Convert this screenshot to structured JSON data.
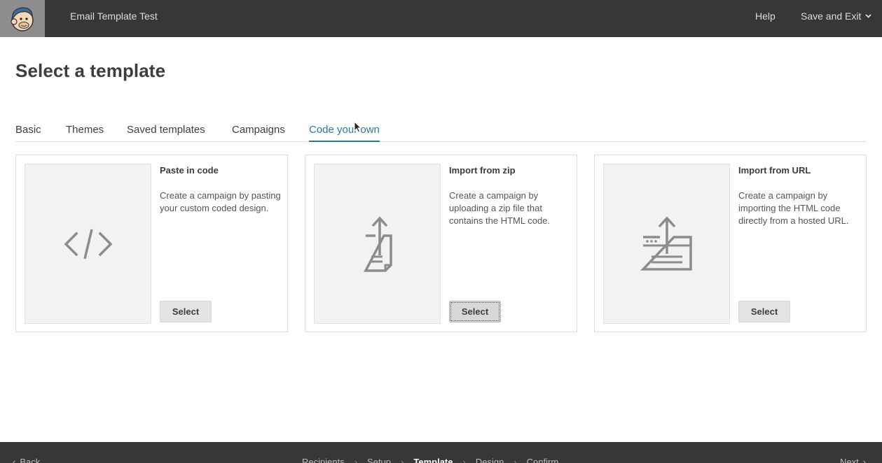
{
  "topbar": {
    "title": "Email Template Test",
    "help_label": "Help",
    "save_exit_label": "Save and Exit",
    "logo_icon": "chimp-logo-icon",
    "chevron_icon": "chevron-down-icon"
  },
  "page": {
    "title": "Select a template"
  },
  "tabs": [
    {
      "label": "Basic",
      "active": false
    },
    {
      "label": "Themes",
      "active": false
    },
    {
      "label": "Saved templates",
      "active": false
    },
    {
      "label": "Campaigns",
      "active": false
    },
    {
      "label": "Code your own",
      "active": true
    }
  ],
  "cards": [
    {
      "title": "Paste in code",
      "description": "Create a campaign by pasting your custom coded design.",
      "button_label": "Select",
      "icon": "code-icon"
    },
    {
      "title": "Import from zip",
      "description": "Create a campaign by uploading a zip file that contains the HTML code.",
      "button_label": "Select",
      "icon": "zip-upload-icon"
    },
    {
      "title": "Import from URL",
      "description": "Create a campaign by importing the HTML code directly from a hosted URL.",
      "button_label": "Select",
      "icon": "url-import-icon"
    }
  ],
  "footer": {
    "back_label": "Back",
    "next_label": "Next",
    "steps": [
      "Recipients",
      "Setup",
      "Template",
      "Design",
      "Confirm"
    ],
    "current_step": "Template"
  },
  "colors": {
    "topbar_bg": "#373737",
    "accent": "#2a7a96",
    "card_border": "#dcdcdc"
  }
}
